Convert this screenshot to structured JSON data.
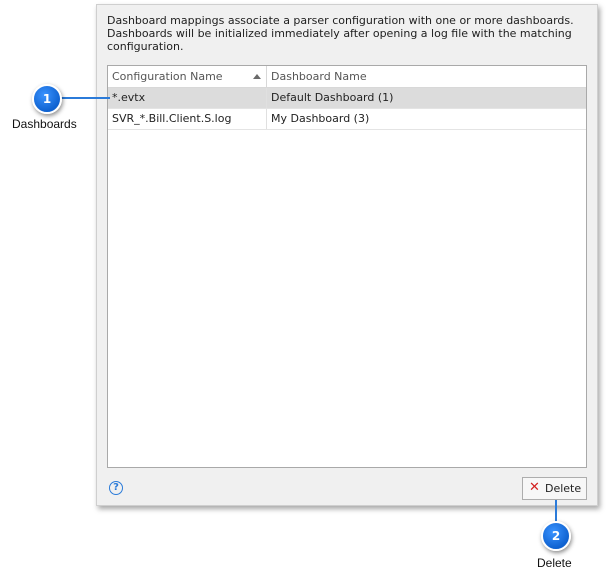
{
  "description": "Dashboard mappings associate a parser configuration with one or more dashboards. Dashboards will be initialized immediately after opening a log file with the matching configuration.",
  "grid": {
    "columns": [
      "Configuration Name",
      "Dashboard Name"
    ],
    "sorted_column": "Configuration Name",
    "sort_direction": "ascending",
    "rows": [
      {
        "config": "*.evtx",
        "dashboard": "Default Dashboard (1)",
        "selected": true
      },
      {
        "config": "SVR_*.Bill.Client.S.log",
        "dashboard": "My Dashboard (3)",
        "selected": false
      }
    ]
  },
  "footer": {
    "help_icon": "?",
    "delete_label": "Delete",
    "delete_icon": "✕"
  },
  "callouts": [
    {
      "number": "1",
      "label": "Dashboards"
    },
    {
      "number": "2",
      "label": "Delete"
    }
  ],
  "colors": {
    "callout": "#1a73e8",
    "delete_icon": "#d32020",
    "selected_row": "#dcdcdc"
  }
}
